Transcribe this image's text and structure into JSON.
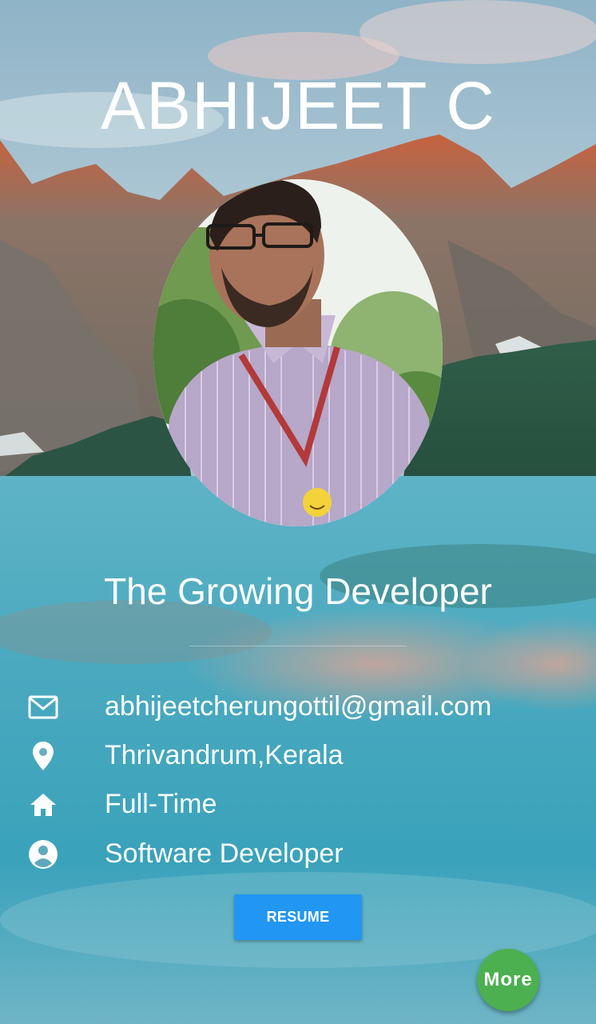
{
  "profile": {
    "name": "ABHIJEET C",
    "tagline": "The Growing Developer"
  },
  "contact": {
    "email": {
      "icon": "mail-icon",
      "value": "abhijeetcherungottil@gmail.com"
    },
    "location": {
      "icon": "location-pin-icon",
      "value": "Thrivandrum,Kerala"
    },
    "employment_type": {
      "icon": "home-icon",
      "value": "Full-Time"
    },
    "role": {
      "icon": "account-circle-icon",
      "value": "Software Developer"
    }
  },
  "actions": {
    "resume_label": "RESUME",
    "more_label": "More"
  },
  "colors": {
    "resume_button": "#2196f3",
    "more_button": "#4caf50",
    "text": "#ffffff"
  }
}
